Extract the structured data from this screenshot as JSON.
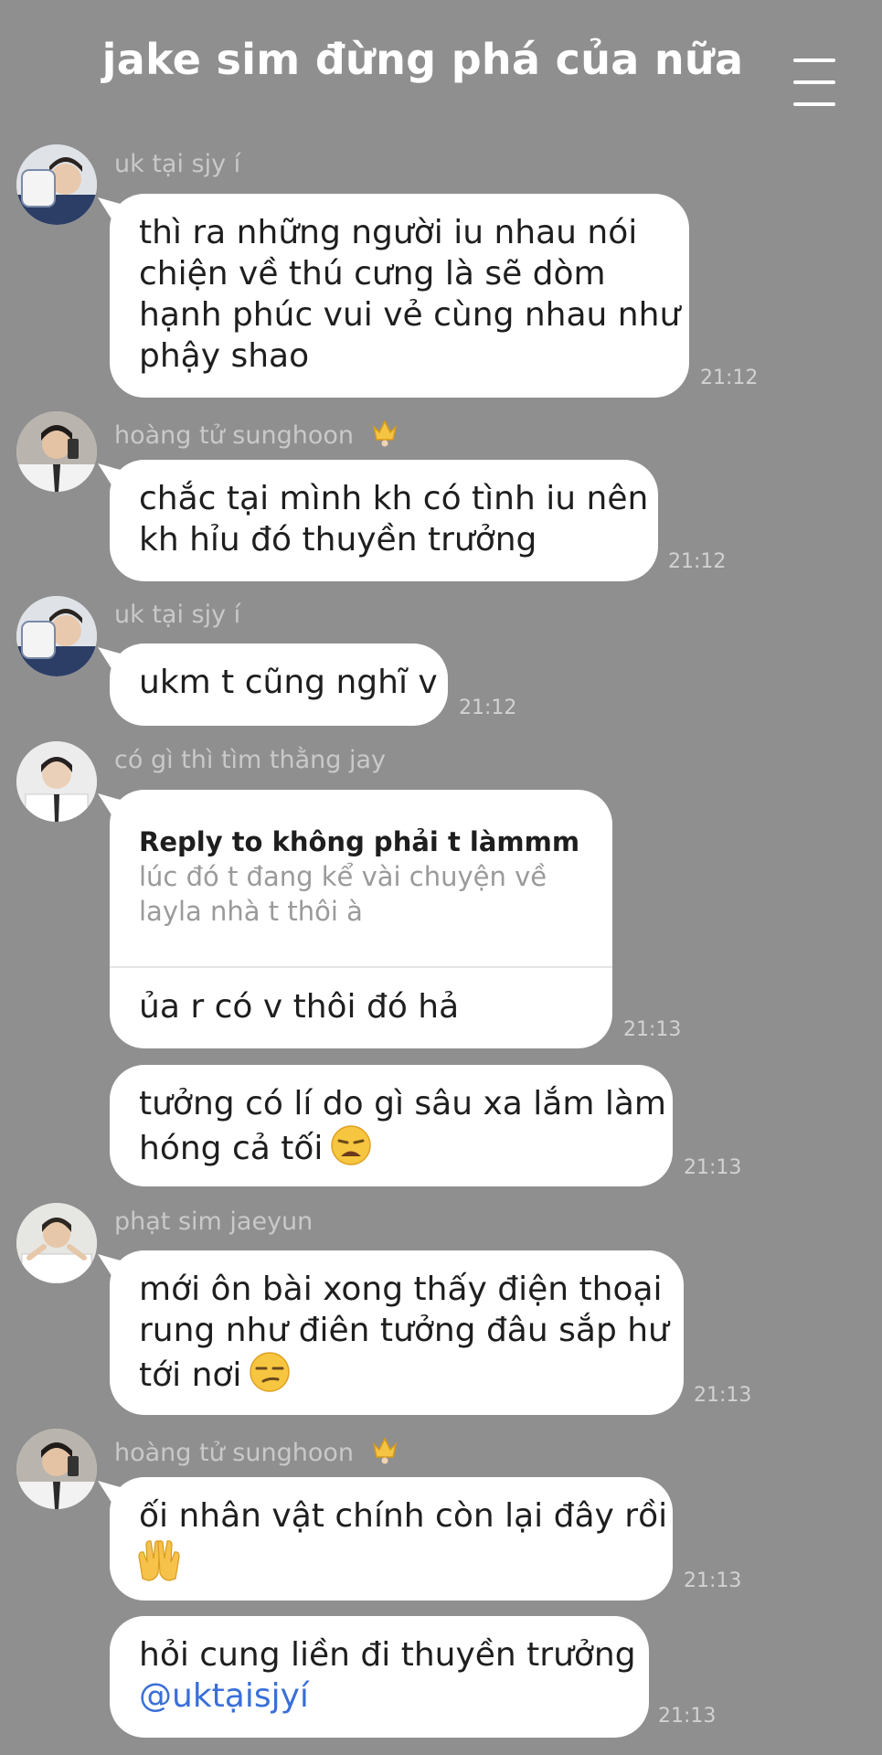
{
  "header": {
    "title": "jake sim đừng phá của nữa",
    "menu_icon": "hamburger-menu-icon"
  },
  "colors": {
    "background": "#8f8f8f",
    "bubble": "#ffffff",
    "mention": "#3a6fd8"
  },
  "messages": [
    {
      "sender": "uk tại sjy í",
      "lines": [
        "thì ra những người iu nhau nói",
        "chiện về thú cưng là sẽ dòm",
        "hạnh phúc vui vẻ cùng nhau như",
        "phậy shao"
      ],
      "time": "21:12"
    },
    {
      "sender": "hoàng tử sunghoon",
      "sender_icon": "crown-emoji",
      "lines": [
        "chắc tại mình kh có tình iu nên",
        "kh hỉu đó thuyền trưởng"
      ],
      "time": "21:12"
    },
    {
      "sender": "uk tại sjy í",
      "lines": [
        "ukm t cũng nghĩ v"
      ],
      "time": "21:12"
    },
    {
      "sender": "có gì thì tìm thằng jay",
      "reply": {
        "header": "Reply to không phải t làmmm",
        "quote": [
          "lúc đó t đang kể vài chuyện về",
          "layla nhà t thôi à"
        ]
      },
      "lines": [
        "ủa r có v thôi đó hả"
      ],
      "time": "21:13"
    },
    {
      "lines": [
        "tưởng có lí do gì sâu xa lắm làm",
        "hóng cả tối"
      ],
      "emoji": "weary-face-emoji",
      "time": "21:13"
    },
    {
      "sender": "phạt sim jaeyun",
      "lines": [
        "mới ôn bài xong thấy điện thoại",
        "rung như điên tưởng đâu sắp hư",
        "tới nơi"
      ],
      "emoji": "unamused-face-emoji",
      "time": "21:13"
    },
    {
      "sender": "hoàng tử sunghoon",
      "sender_icon": "crown-emoji",
      "lines": [
        "ối nhân vật chính còn lại đây rồi"
      ],
      "emoji": "raising-hands-emoji",
      "time": "21:13"
    },
    {
      "lines": [
        "hỏi cung liền đi thuyền trưởng"
      ],
      "mention": "@uktạisjyí",
      "time": "21:13"
    }
  ]
}
